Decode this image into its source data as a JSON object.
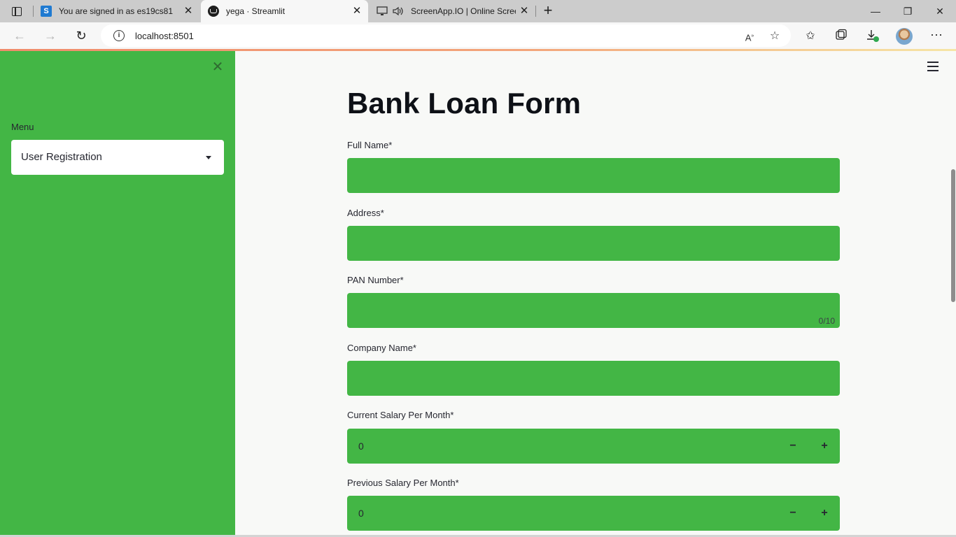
{
  "browser": {
    "tabs": [
      {
        "title": "You are signed in as es19cs81",
        "favicon": "S"
      },
      {
        "title": "yega · Streamlit",
        "favicon": "streamlit-icon"
      },
      {
        "title": "ScreenApp.IO | Online Scree",
        "favicon": "screen-share-icon"
      }
    ],
    "url": "localhost:8501",
    "close_glyph": "✕",
    "new_tab_glyph": "+",
    "window_controls": {
      "minimize": "—",
      "restore": "❐",
      "close": "✕"
    }
  },
  "sidebar": {
    "close_glyph": "✕",
    "menu_label": "Menu",
    "selected_option": "User Registration"
  },
  "main": {
    "title": "Bank Loan Form",
    "fields": [
      {
        "label": "Full Name*",
        "value": ""
      },
      {
        "label": "Address*",
        "value": ""
      },
      {
        "label": "PAN Number*",
        "value": "",
        "counter": "0/10"
      },
      {
        "label": "Company Name*",
        "value": ""
      },
      {
        "label": "Current Salary Per Month*",
        "value": "0"
      },
      {
        "label": "Previous Salary Per Month*",
        "value": "0"
      }
    ],
    "stepper_minus": "−",
    "stepper_plus": "+"
  },
  "colors": {
    "sidebar": "#43b645",
    "field": "#43b645",
    "background": "#f8f9f7"
  }
}
